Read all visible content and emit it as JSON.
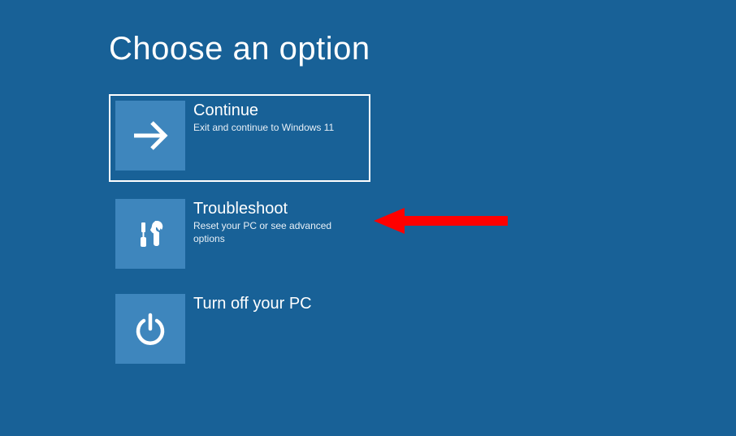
{
  "heading": "Choose an option",
  "options": [
    {
      "title": "Continue",
      "desc": "Exit and continue to Windows 11",
      "icon": "arrow-right",
      "selected": true
    },
    {
      "title": "Troubleshoot",
      "desc": "Reset your PC or see advanced options",
      "icon": "tools",
      "selected": false
    },
    {
      "title": "Turn off your PC",
      "desc": "",
      "icon": "power",
      "selected": false
    }
  ]
}
